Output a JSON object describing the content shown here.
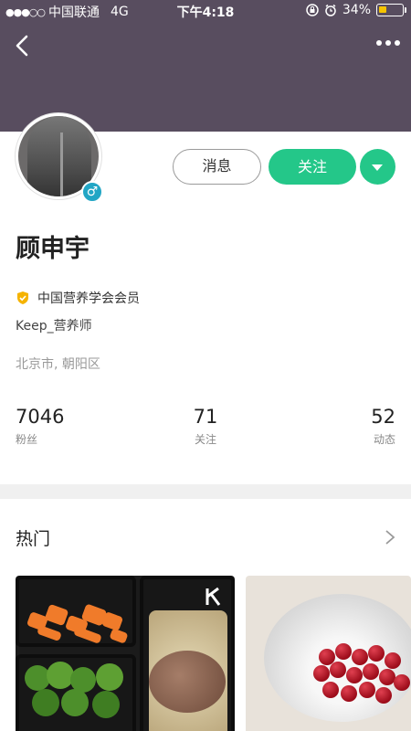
{
  "status_bar": {
    "signal": "●●●○○",
    "carrier": "中国联通",
    "network": "4G",
    "time": "下午4:18",
    "battery_percent": "34%",
    "battery_level": 0.34,
    "icons": [
      "rotation-lock-icon",
      "alarm-icon"
    ]
  },
  "colors": {
    "header_bg": "#584d5f",
    "accent": "#24c789",
    "badge": "#22a6c5",
    "cert": "#f5b300"
  },
  "profile": {
    "name": "顾申宇",
    "gender_symbol": "♂",
    "certification": "中国营养学会会员",
    "title": "Keep_营养师",
    "location": "北京市, 朝阳区"
  },
  "actions": {
    "message_label": "消息",
    "follow_label": "关注"
  },
  "stats": {
    "fans": {
      "value": "7046",
      "label": "粉丝"
    },
    "following": {
      "value": "71",
      "label": "关注"
    },
    "posts": {
      "value": "52",
      "label": "动态"
    }
  },
  "section": {
    "title": "热门"
  }
}
